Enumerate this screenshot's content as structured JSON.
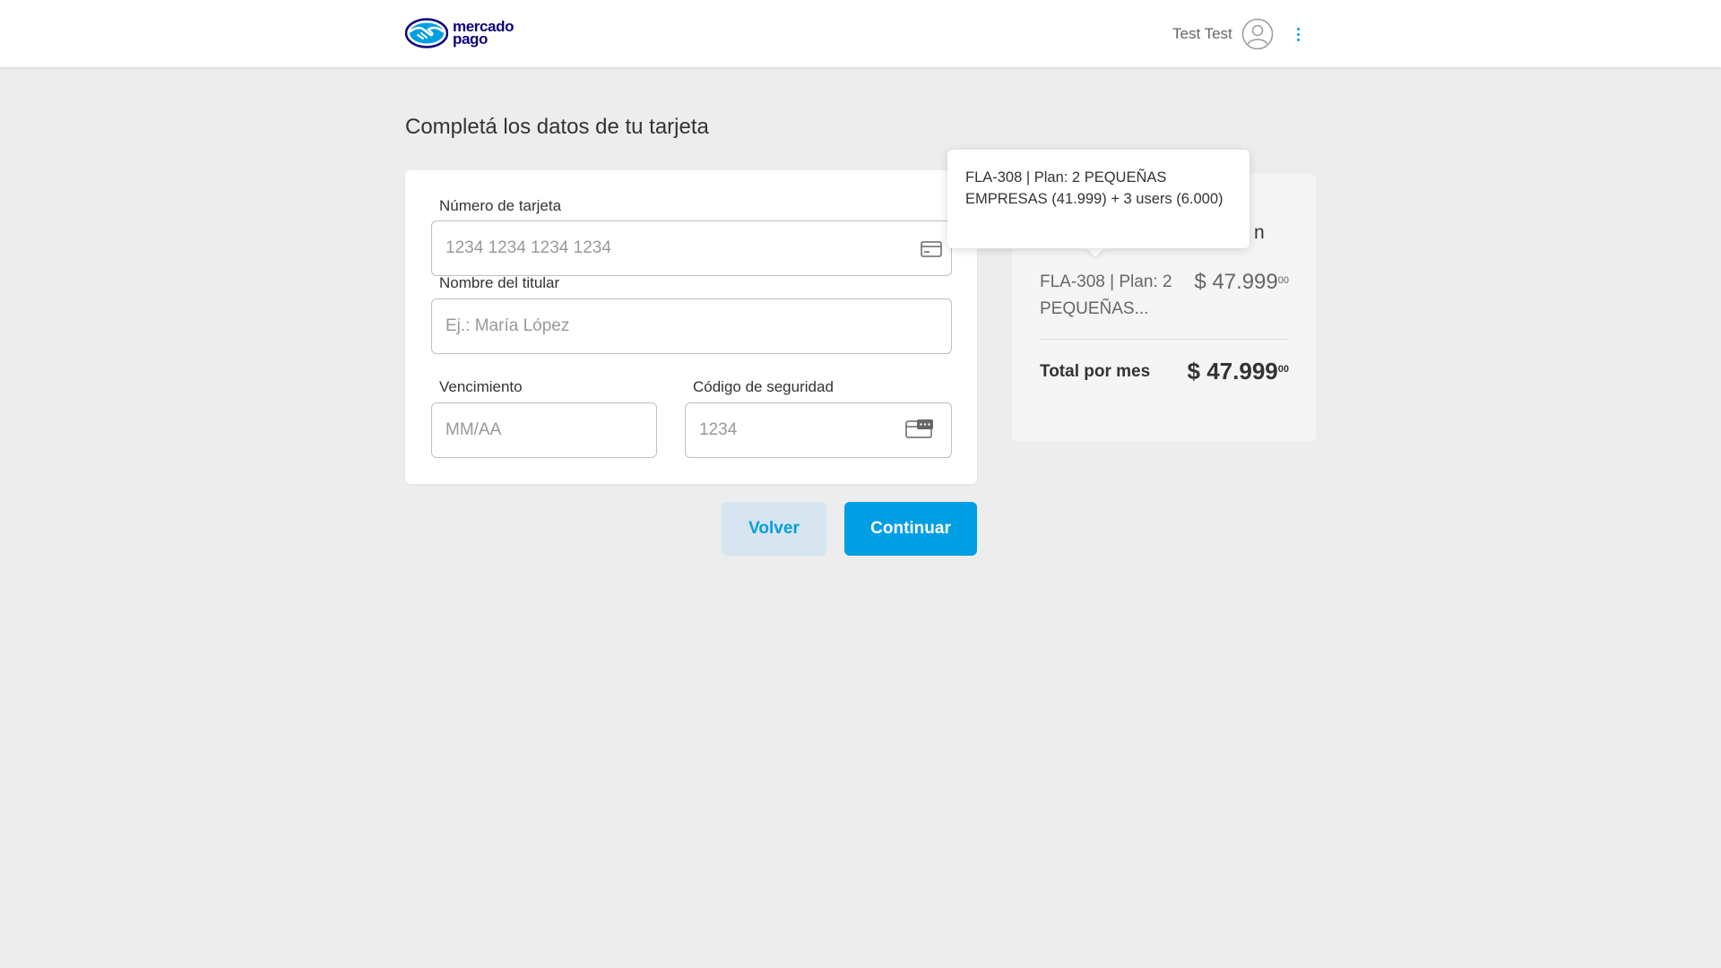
{
  "header": {
    "logo_line1": "mercado",
    "logo_line2": "pago",
    "user_name": "Test Test"
  },
  "page": {
    "title": "Completá los datos de tu tarjeta"
  },
  "form": {
    "card_number": {
      "label": "Número de tarjeta",
      "placeholder": "1234 1234 1234 1234",
      "value": ""
    },
    "holder_name": {
      "label": "Nombre del titular",
      "placeholder": "Ej.: María López",
      "value": ""
    },
    "expiration": {
      "label": "Vencimiento",
      "placeholder": "MM/AA",
      "value": ""
    },
    "security_code": {
      "label": "Código de seguridad",
      "placeholder": "1234",
      "value": ""
    }
  },
  "buttons": {
    "back": "Volver",
    "continue": "Continuar"
  },
  "summary": {
    "title_visible_fragment": "n",
    "item_name": "FLA-308 | Plan: 2 PEQUEÑAS...",
    "item_price_main": "$ 47.999",
    "item_price_cents": "00",
    "total_label": "Total por mes",
    "total_price_main": "$ 47.999",
    "total_price_cents": "00"
  },
  "tooltip": {
    "text": "FLA-308 | Plan: 2 PEQUEÑAS EMPRESAS (41.999) + 3 users (6.000)"
  },
  "colors": {
    "accent": "#009ee3",
    "background": "#ededed",
    "brand_dark": "#0a0080",
    "back_button_bg": "#d6e5ef"
  }
}
